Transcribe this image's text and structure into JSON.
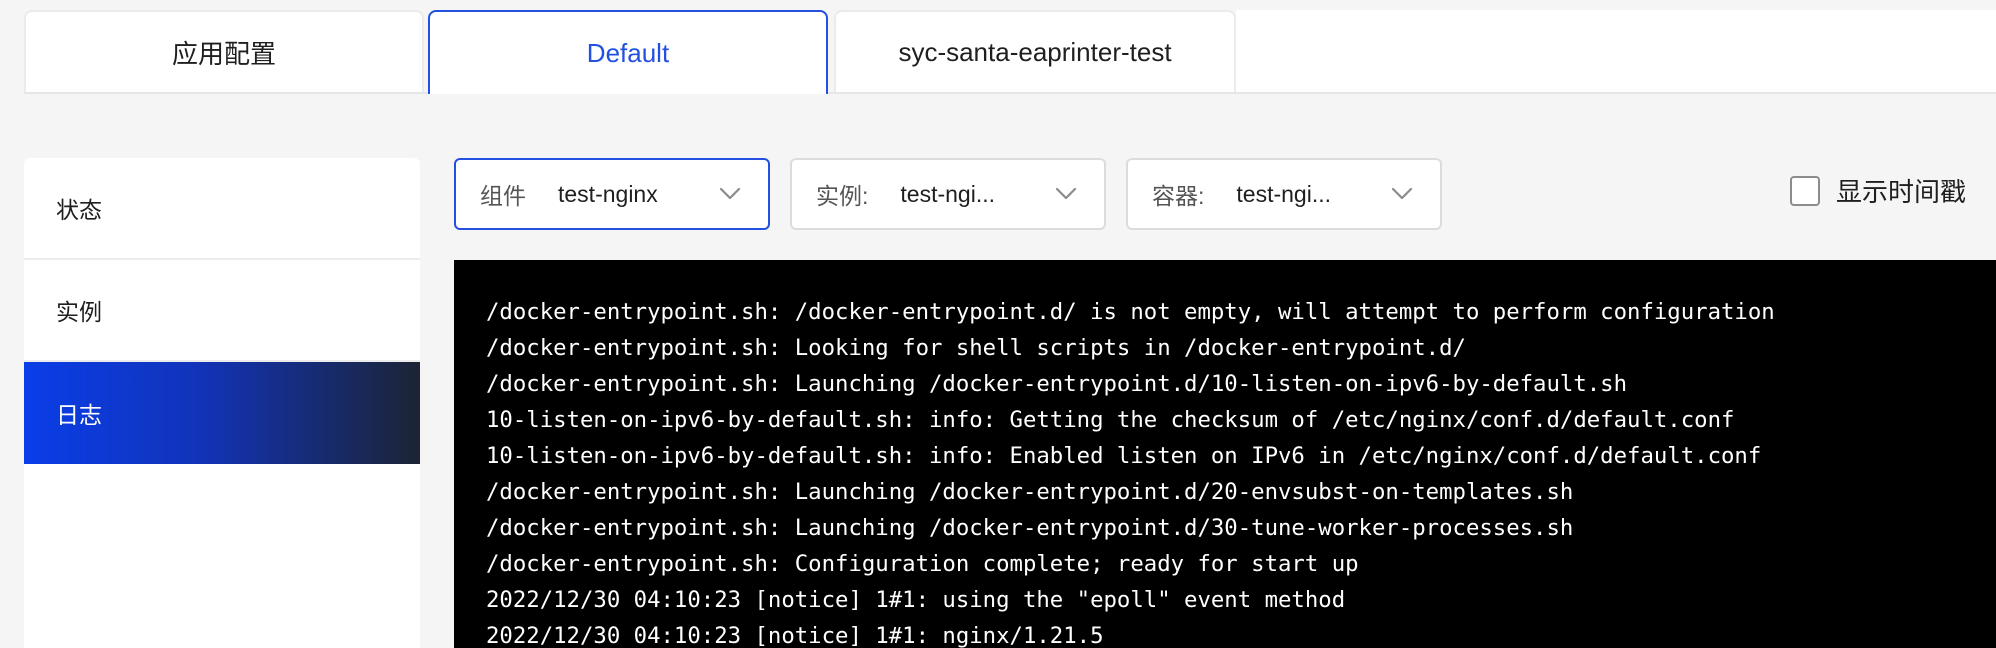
{
  "tabs": [
    {
      "label": "应用配置",
      "active": false
    },
    {
      "label": "Default",
      "active": true
    },
    {
      "label": "syc-santa-eaprinter-test",
      "active": false
    }
  ],
  "sidebar": {
    "items": [
      {
        "label": "状态",
        "active": false
      },
      {
        "label": "实例",
        "active": false
      },
      {
        "label": "日志",
        "active": true
      }
    ]
  },
  "filters": {
    "component": {
      "label": "组件",
      "value": "test-nginx"
    },
    "instance": {
      "label": "实例:",
      "value": "test-ngi..."
    },
    "container": {
      "label": "容器:",
      "value": "test-ngi..."
    },
    "show_timestamp": {
      "label": "显示时间戳",
      "checked": false
    }
  },
  "logs": [
    "/docker-entrypoint.sh: /docker-entrypoint.d/ is not empty, will attempt to perform configuration",
    "/docker-entrypoint.sh: Looking for shell scripts in /docker-entrypoint.d/",
    "/docker-entrypoint.sh: Launching /docker-entrypoint.d/10-listen-on-ipv6-by-default.sh",
    "10-listen-on-ipv6-by-default.sh: info: Getting the checksum of /etc/nginx/conf.d/default.conf",
    "10-listen-on-ipv6-by-default.sh: info: Enabled listen on IPv6 in /etc/nginx/conf.d/default.conf",
    "/docker-entrypoint.sh: Launching /docker-entrypoint.d/20-envsubst-on-templates.sh",
    "/docker-entrypoint.sh: Launching /docker-entrypoint.d/30-tune-worker-processes.sh",
    "/docker-entrypoint.sh: Configuration complete; ready for start up",
    "2022/12/30 04:10:23 [notice] 1#1: using the \"epoll\" event method",
    "2022/12/30 04:10:23 [notice] 1#1: nginx/1.21.5"
  ],
  "colors": {
    "accent": "#2350e0",
    "terminal_bg": "#000000",
    "terminal_fg": "#ffffff"
  }
}
